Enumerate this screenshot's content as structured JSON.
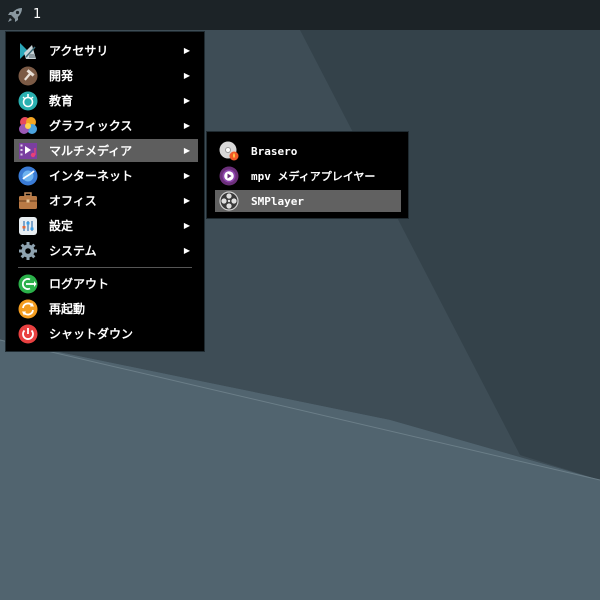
{
  "taskbar": {
    "launcher_icon": "rocket-icon",
    "workspace_number": "1"
  },
  "main_menu": {
    "categories": [
      {
        "label": "アクセサリ",
        "icon": "accessories-icon",
        "has_submenu": true
      },
      {
        "label": "開発",
        "icon": "development-icon",
        "has_submenu": true
      },
      {
        "label": "教育",
        "icon": "education-icon",
        "has_submenu": true
      },
      {
        "label": "グラフィックス",
        "icon": "graphics-icon",
        "has_submenu": true
      },
      {
        "label": "マルチメディア",
        "icon": "multimedia-icon",
        "has_submenu": true,
        "active": true
      },
      {
        "label": "インターネット",
        "icon": "internet-icon",
        "has_submenu": true
      },
      {
        "label": "オフィス",
        "icon": "office-icon",
        "has_submenu": true
      },
      {
        "label": "設定",
        "icon": "settings-icon",
        "has_submenu": true
      },
      {
        "label": "システム",
        "icon": "system-icon",
        "has_submenu": true
      }
    ],
    "actions": [
      {
        "label": "ログアウト",
        "icon": "logout-icon"
      },
      {
        "label": "再起動",
        "icon": "reboot-icon"
      },
      {
        "label": "シャットダウン",
        "icon": "shutdown-icon"
      }
    ]
  },
  "submenu": {
    "items": [
      {
        "label": "Brasero",
        "icon": "brasero-icon"
      },
      {
        "label": "mpv メディアプレイヤー",
        "icon": "mpv-icon"
      },
      {
        "label": "SMPlayer",
        "icon": "smplayer-icon",
        "active": true
      }
    ]
  },
  "colors": {
    "taskbar": "#1c2327",
    "desktop": "#4d606b",
    "menu_bg": "#000000",
    "highlight": "#5e5e5e"
  }
}
